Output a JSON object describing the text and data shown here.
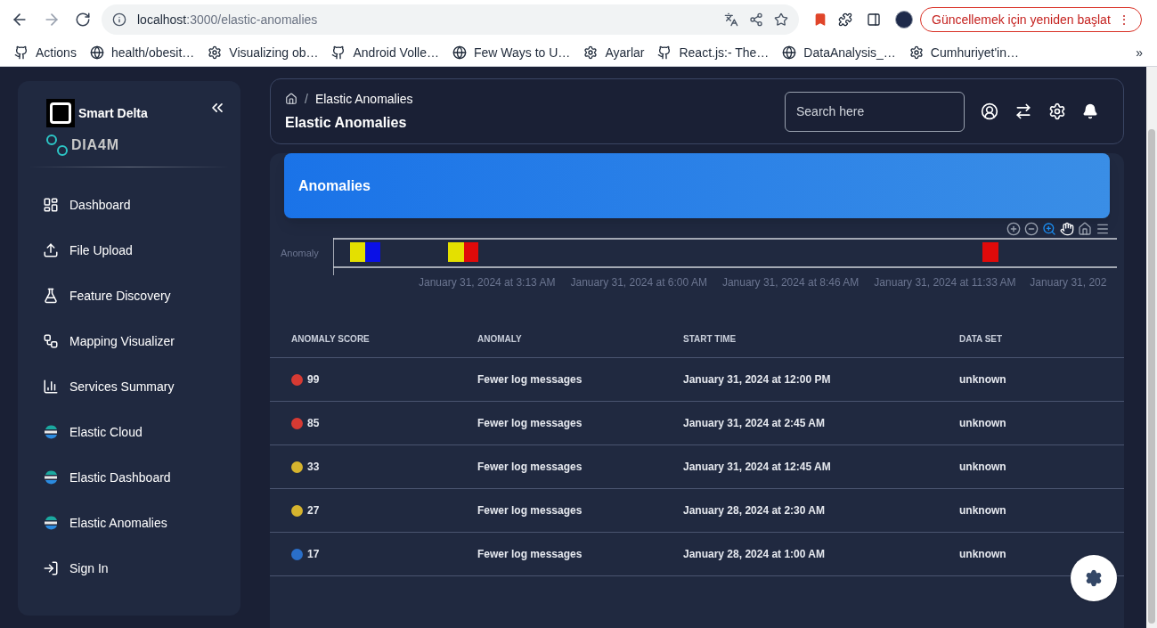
{
  "browser": {
    "url_host": "localhost",
    "url_path": ":3000/elastic-anomalies",
    "update_button": "Güncellemek için yeniden başlat",
    "update_menu": "⋮",
    "bookmarks": [
      "Actions",
      "health/obesit…",
      "Visualizing ob…",
      "Android Volle…",
      "Few Ways to U…",
      "Ayarlar",
      "React.js:- The…",
      "DataAnalysis_…",
      "Cumhuriyet'in…"
    ],
    "more": "»"
  },
  "sidebar": {
    "brand": "Smart Delta",
    "product": "DIA4M",
    "items": [
      {
        "label": "Dashboard",
        "kind": "dashboard",
        "selected": false
      },
      {
        "label": "File Upload",
        "kind": "upload",
        "selected": false
      },
      {
        "label": "Feature Discovery",
        "kind": "flask",
        "selected": false
      },
      {
        "label": "Mapping Visualizer",
        "kind": "tree",
        "selected": false
      },
      {
        "label": "Services Summary",
        "kind": "bars",
        "selected": false
      },
      {
        "label": "Elastic Cloud",
        "kind": "elastic",
        "selected": false
      },
      {
        "label": "Elastic Dashboard",
        "kind": "elastic",
        "selected": false
      },
      {
        "label": "Elastic Anomalies",
        "kind": "elastic",
        "selected": false
      },
      {
        "label": "Sign In",
        "kind": "signin",
        "selected": false
      }
    ]
  },
  "header": {
    "breadcrumb": "Elastic Anomalies",
    "separator": "/",
    "title": "Elastic Anomalies",
    "search": {
      "placeholder": "Search here"
    }
  },
  "banner": {
    "title": "Anomalies"
  },
  "timeline": {
    "lane": "Anomaly",
    "axis_labels": [
      "January 31, 2024 at 3:13 AM",
      "January 31, 2024 at 6:00 AM",
      "January 31, 2024 at 8:46 AM",
      "January 31, 2024 at 11:33 AM",
      "January 31, 202"
    ]
  },
  "table": {
    "columns": [
      "ANOMALY SCORE",
      "ANOMALY",
      "START TIME",
      "DATA SET"
    ],
    "rows": [
      {
        "color": "#d63a33",
        "score": "99",
        "anomaly": "Fewer log messages",
        "start": "January 31, 2024 at 12:00 PM",
        "dataset": "unknown"
      },
      {
        "color": "#d63a33",
        "score": "85",
        "anomaly": "Fewer log messages",
        "start": "January 31, 2024 at 2:45 AM",
        "dataset": "unknown"
      },
      {
        "color": "#d6b42e",
        "score": "33",
        "anomaly": "Fewer log messages",
        "start": "January 31, 2024 at 12:45 AM",
        "dataset": "unknown"
      },
      {
        "color": "#d6b42e",
        "score": "27",
        "anomaly": "Fewer log messages",
        "start": "January 28, 2024 at 2:30 AM",
        "dataset": "unknown"
      },
      {
        "color": "#2a6fc9",
        "score": "17",
        "anomaly": "Fewer log messages",
        "start": "January 28, 2024 at 1:00 AM",
        "dataset": "unknown"
      }
    ]
  }
}
